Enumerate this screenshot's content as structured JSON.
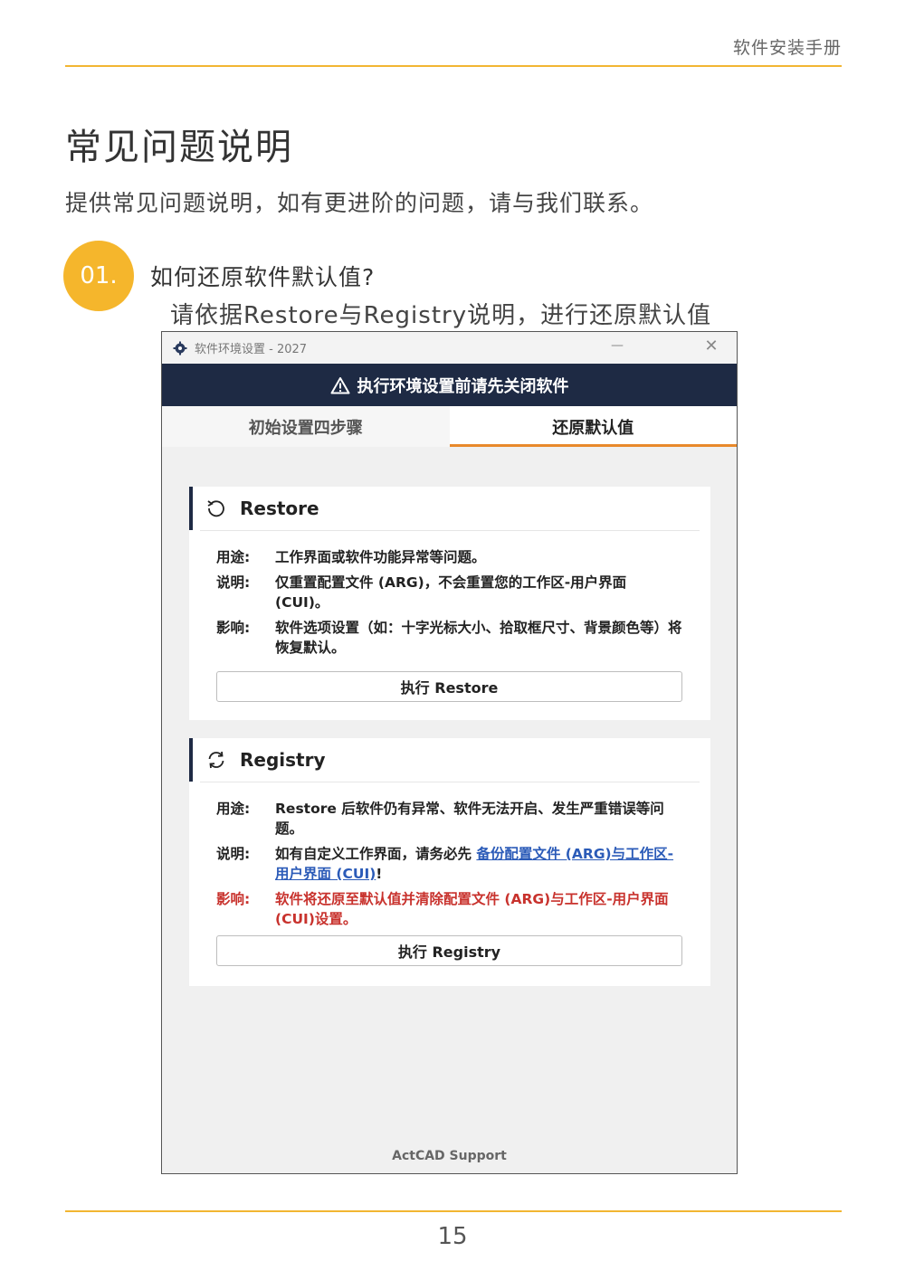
{
  "header": {
    "manual_title": "软件安装手册"
  },
  "page": {
    "title": "常见问题说明",
    "intro": "提供常见问题说明，如有更进阶的问题，请与我们联系。",
    "question": {
      "number": "01.",
      "title": "如何还原软件默认值?",
      "subtitle": "请依据Restore与Registry说明，进行还原默认值"
    },
    "page_number": "15"
  },
  "window": {
    "title": "软件环境设置 - 2027",
    "controls": {
      "minimize": "—",
      "close": "✕"
    },
    "warning": "执行环境设置前请先关闭软件",
    "tabs": [
      {
        "label": "初始设置四步骤",
        "active": false
      },
      {
        "label": "还原默认值",
        "active": true
      }
    ],
    "restore": {
      "title": "Restore",
      "usage_label": "用途:",
      "usage": "工作界面或软件功能异常等问题。",
      "desc_label": "说明:",
      "desc": "仅重置配置文件 (ARG)，不会重置您的工作区-用户界面 (CUI)。",
      "impact_label": "影响:",
      "impact": "软件选项设置（如：十字光标大小、拾取框尺寸、背景颜色等）将恢复默认。",
      "button": "执行 Restore"
    },
    "registry": {
      "title": "Registry",
      "usage_label": "用途:",
      "usage": "Restore 后软件仍有异常、软件无法开启、发生严重错误等问题。",
      "desc_label": "说明:",
      "desc_prefix": "如有自定义工作界面，请务必先 ",
      "desc_link": "备份配置文件 (ARG)与工作区-用户界面 (CUI)",
      "desc_suffix": "!",
      "impact_label": "影响:",
      "impact": "软件将还原至默认值并清除配置文件 (ARG)与工作区-用户界面 (CUI)设置。",
      "button": "执行 Registry"
    },
    "footer": "ActCAD Support"
  },
  "colors": {
    "accent": "#f2b632",
    "navy": "#1e2a44",
    "tab_underline": "#e8892b",
    "danger": "#c8322d",
    "link": "#2b5bb8"
  }
}
